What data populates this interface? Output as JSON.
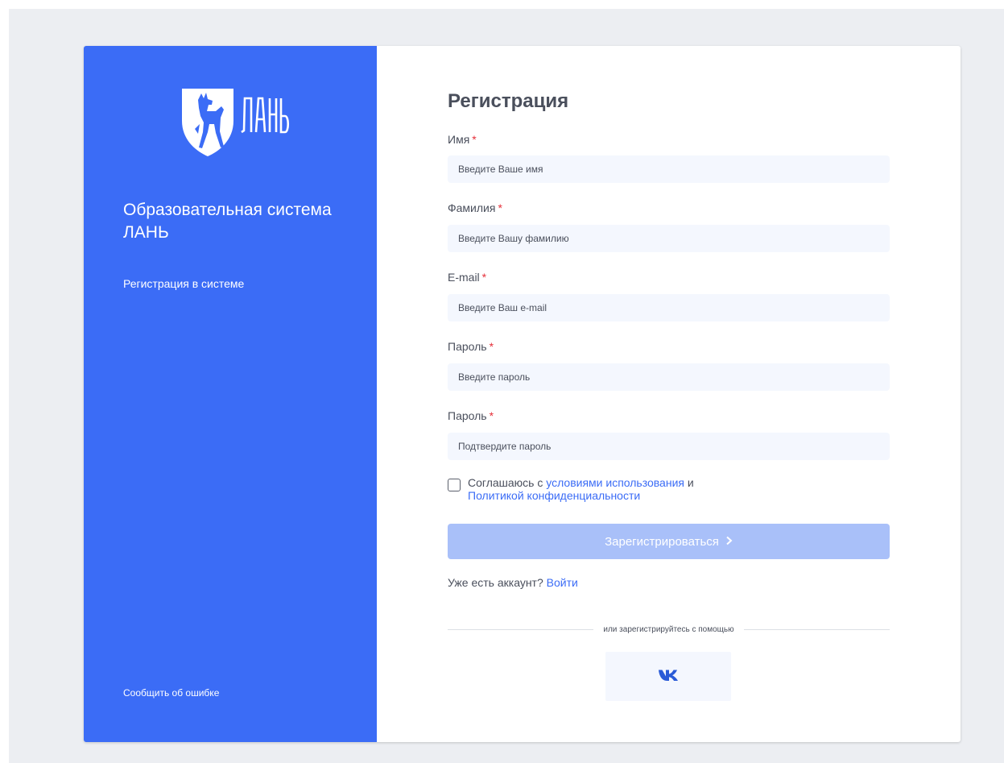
{
  "brand": {
    "logo_text": "ЛАНЬ",
    "title": "Образовательная система ЛАНЬ",
    "subtitle": "Регистрация в системе",
    "report_link": "Сообщить об ошибке"
  },
  "form": {
    "title": "Регистрация",
    "required_mark": "*",
    "fields": [
      {
        "label": "Имя",
        "placeholder": "Введите Ваше имя"
      },
      {
        "label": "Фамилия",
        "placeholder": "Введите Вашу фамилию"
      },
      {
        "label": "E-mail",
        "placeholder": "Введите Ваш e-mail"
      },
      {
        "label": "Пароль",
        "placeholder": "Введите пароль"
      },
      {
        "label": "Пароль",
        "placeholder": "Подтвердите пароль"
      }
    ],
    "agree": {
      "checked": false,
      "prefix": "Соглашаюсь с",
      "terms_link": "условиями использования",
      "and": "и",
      "privacy_link": "Политикой конфиденциальности"
    },
    "submit_label": "Зарегистрироваться",
    "have_account_text": "Уже есть аккаунт?",
    "login_link": "Войти",
    "divider_text": "или зарегистрируйтесь с помощью",
    "social": [
      {
        "name": "vk",
        "icon": "vk-icon",
        "label": "VK"
      }
    ]
  },
  "colors": {
    "brand_blue": "#3b6cf6",
    "button_disabled": "#a9c0f9",
    "required": "#e5303a",
    "input_bg": "#f4f7fe",
    "page_bg": "#eceef2"
  }
}
